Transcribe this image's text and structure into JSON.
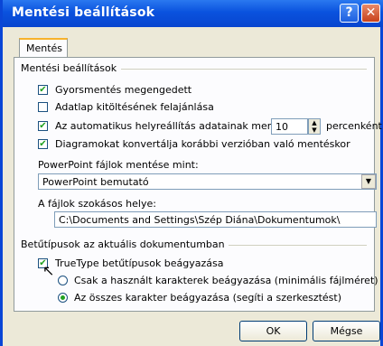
{
  "window": {
    "title": "Mentési beállítások",
    "help_label": "?",
    "close_label": "✕"
  },
  "tab": {
    "label": "Mentés"
  },
  "group_save": {
    "label": "Mentési beállítások",
    "fast_save": {
      "label": "Gyorsmentés megengedett",
      "checked": true
    },
    "form_fill": {
      "label": "Adatlap kitöltésének felajánlása",
      "checked": false
    },
    "autorecover": {
      "label": "Az automatikus helyreállítás adatainak mentése",
      "value": "10",
      "unit": "percenként",
      "checked": true
    },
    "convert_diagrams": {
      "label": "Diagramokat konvertálja korábbi verzióban való mentéskor",
      "checked": true
    }
  },
  "save_as": {
    "label": "PowerPoint fájlok mentése mint:",
    "value": "PowerPoint bemutató"
  },
  "location": {
    "label": "A fájlok szokásos helye:",
    "value": "C:\\Documents and Settings\\Szép Diána\\Dokumentumok\\"
  },
  "group_fonts": {
    "label": "Betűtípusok az aktuális dokumentumban",
    "truetype": {
      "label": "TrueType betűtípusok beágyazása",
      "checked": true
    },
    "used_chars": {
      "label": "Csak a használt karakterek beágyazása (minimális fájlméret)",
      "selected": false
    },
    "all_chars": {
      "label": "Az összes karakter beágyazása (segíti a szerkesztést)",
      "selected": true
    }
  },
  "buttons": {
    "ok": "OK",
    "cancel": "Mégse"
  }
}
